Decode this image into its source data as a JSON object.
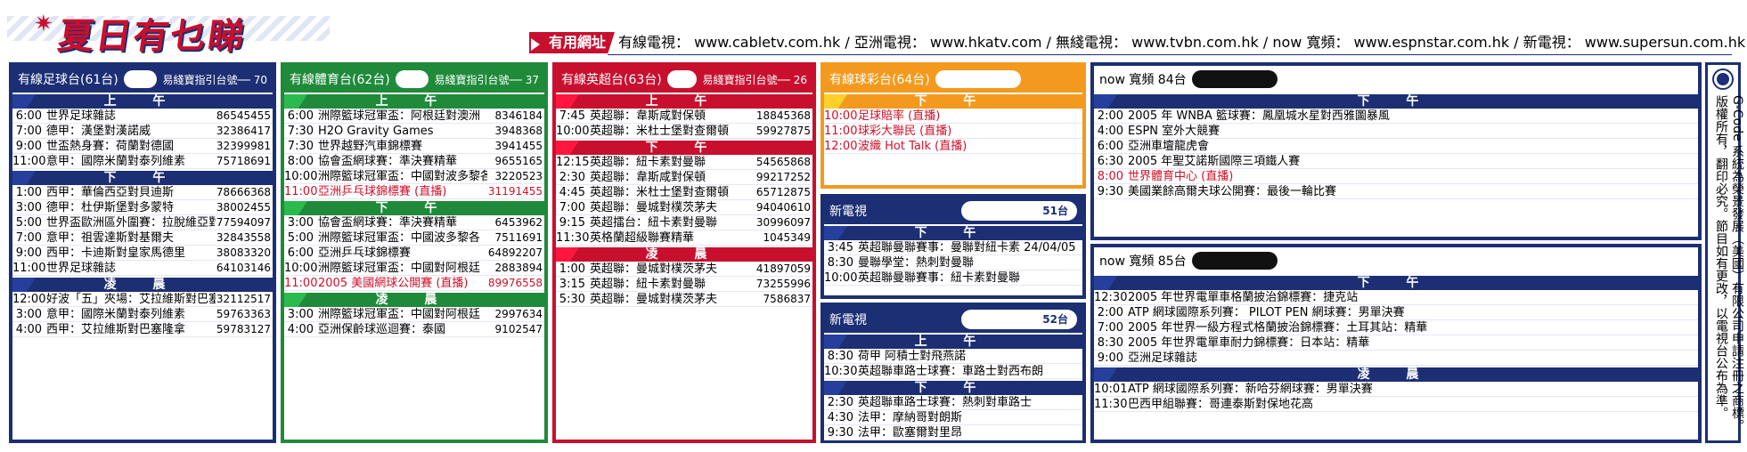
{
  "header": {
    "logo_text": "夏日有乜睇",
    "tag": "有用網址",
    "urls": "有線電視： www.cabletv.com.hk / 亞洲電視： www.hkatv.com / 無綫電視： www.tvbn.com.hk / now 寬頻： www.espnstar.com.hk / 新電視： www.supersun.com.hk"
  },
  "panel1": {
    "channel": "有線足球台(61台)",
    "guide": "易綫寶指引台號── 70",
    "period_am": "上 午",
    "period_pm": "下 午",
    "period_late": "凌 晨",
    "am": [
      {
        "t": "6:00",
        "p": "世界足球雜誌",
        "n": "86545455"
      },
      {
        "t": "7:00",
        "p": "德甲：漢堡對漢諾威",
        "n": "32386417"
      },
      {
        "t": "9:00",
        "p": "世盃熱身賽：荷蘭對德國",
        "n": "32399981"
      },
      {
        "t": "11:00",
        "p": "意甲：國際米蘭對泰列維素",
        "n": "75718691"
      }
    ],
    "pm": [
      {
        "t": "1:00",
        "p": "西甲：華倫西亞對貝迪斯",
        "n": "78666368"
      },
      {
        "t": "3:00",
        "p": "德甲：杜伊斯堡對多蒙特",
        "n": "38002455"
      },
      {
        "t": "5:00",
        "p": "世界盃歐洲區外圍賽：拉脫維亞對俄羅斯",
        "n": "77594097"
      },
      {
        "t": "7:00",
        "p": "意甲：祖雲達斯對基爾夫",
        "n": "32843558"
      },
      {
        "t": "9:00",
        "p": "西甲：卡迪斯對皇家馬德里",
        "n": "38083320"
      },
      {
        "t": "11:00",
        "p": "世界足球雜誌",
        "n": "64103146"
      }
    ],
    "late": [
      {
        "t": "12:00",
        "p": "好波「五」夾場：艾拉維斯對巴塞隆拿",
        "n": "32112517"
      },
      {
        "t": "3:00",
        "p": "意甲：國際米蘭對泰列維素",
        "n": "59763363"
      },
      {
        "t": "4:00",
        "p": "西甲：艾拉維斯對巴塞隆拿",
        "n": "59783127"
      }
    ]
  },
  "panel2": {
    "channel": "有線體育台(62台)",
    "guide": "易綫寶指引台號── 37",
    "period_am": "上 午",
    "period_pm": "下 午",
    "period_late": "凌 晨",
    "am": [
      {
        "t": "6:00",
        "p": "洲際籃球冠軍盃：阿根廷對澳洲",
        "n": "8346184"
      },
      {
        "t": "7:30",
        "p": "H2O Gravity Games",
        "n": "3948368"
      },
      {
        "t": "7:30",
        "p": "世界越野汽車錦標賽",
        "n": "3941455"
      },
      {
        "t": "8:00",
        "p": "協會盃網球賽：準決賽精華",
        "n": "9655165"
      },
      {
        "t": "10:00",
        "p": "洲際籃球冠軍盃：中國對波多黎各",
        "n": "3220523"
      },
      {
        "t": "11:00",
        "p": "亞洲乒乓球錦標賽 (直播)",
        "n": "31191455",
        "red": true
      }
    ],
    "pm": [
      {
        "t": "3:00",
        "p": "協會盃網球賽：準決賽精華",
        "n": "6453962"
      },
      {
        "t": "5:00",
        "p": "洲際籃球冠軍盃：中國波多黎各",
        "n": "7511691"
      },
      {
        "t": "6:00",
        "p": "亞洲乒乓球錦標賽",
        "n": "64892207"
      },
      {
        "t": "10:00",
        "p": "洲際籃球冠軍盃：中國對阿根廷",
        "n": "2883894"
      },
      {
        "t": "11:00",
        "p": "2005 美國網球公開賽 (直播)",
        "n": "89976558",
        "red": true
      }
    ],
    "late": [
      {
        "t": "3:00",
        "p": "洲際籃球冠軍盃：中國對阿根廷",
        "n": "2997634"
      },
      {
        "t": "4:00",
        "p": "亞洲保齡球巡迴賽：泰國",
        "n": "9102547"
      }
    ]
  },
  "panel3": {
    "channel": "有線英超台(63台)",
    "guide": "易綫寶指引台號── 26",
    "period_am": "上 午",
    "period_pm": "下 午",
    "period_late": "凌 晨",
    "am": [
      {
        "t": "7:45",
        "p": "英超聯：韋斯咸對保頓",
        "n": "18845368"
      },
      {
        "t": "10:00",
        "p": "英超聯：米杜士堡對查爾頓",
        "n": "59927875"
      }
    ],
    "pm": [
      {
        "t": "12:15",
        "p": "英超聯：紐卡素對曼聯",
        "n": "54565868"
      },
      {
        "t": "2:30",
        "p": "英超聯：韋斯咸對保頓",
        "n": "99217252"
      },
      {
        "t": "4:45",
        "p": "英超聯：米杜士堡對查爾頓",
        "n": "65712875"
      },
      {
        "t": "7:00",
        "p": "英超聯：曼城對樸茨茅夫",
        "n": "94040610"
      },
      {
        "t": "9:15",
        "p": "英超擂台：紐卡素對曼聯",
        "n": "30996097"
      },
      {
        "t": "11:30",
        "p": "英格蘭超級聯賽精華",
        "n": "1045349"
      }
    ],
    "late": [
      {
        "t": "1:00",
        "p": "英超聯：曼城對樸茨茅夫",
        "n": "41897059"
      },
      {
        "t": "3:15",
        "p": "英超聯：紐卡素對曼聯",
        "n": "73255996"
      },
      {
        "t": "5:30",
        "p": "英超聯：曼城對樸茨茅夫",
        "n": "7586837"
      }
    ]
  },
  "panel4": {
    "channel": "有線球彩台(64台)",
    "period_pm": "下 午",
    "pm": [
      {
        "t": "10:00",
        "p": "足球賠率 (直播)",
        "red": true
      },
      {
        "t": "11:00",
        "p": "球彩大聯民 (直播)",
        "red": true
      },
      {
        "t": "12:00",
        "p": "波織 Hot Talk (直播)",
        "red": true
      }
    ],
    "new1": {
      "channel": "新電視",
      "num": "51台",
      "period": "下 午",
      "rows": [
        {
          "t": "3:45",
          "p": "英超聯曼聯賽事：曼聯對紐卡素 24/04/05"
        },
        {
          "t": "8:30",
          "p": "曼聯學堂：熱刺對曼聯"
        },
        {
          "t": "10:00",
          "p": "英超聯曼聯賽事：紐卡素對曼聯"
        }
      ]
    },
    "new2": {
      "channel": "新電視",
      "num": "52台",
      "period_am": "上 午",
      "period_pm": "下 午",
      "am": [
        {
          "t": "8:30",
          "p": "荷甲 阿積士對飛燕諾"
        },
        {
          "t": "10:30",
          "p": "英超聯車路士球賽：車路士對西布朗"
        }
      ],
      "pm": [
        {
          "t": "2:30",
          "p": "英超聯車路士球賽：熱刺對車路士"
        },
        {
          "t": "4:30",
          "p": "法甲：摩納哥對朗斯"
        },
        {
          "t": "9:30",
          "p": "法甲：歐塞爾對里昂"
        }
      ]
    }
  },
  "panel5": {
    "ch84": "now 寬頻 84台",
    "ch85": "now 寬頻 85台",
    "period_pm": "下 午",
    "period_late": "凌 晨",
    "rows84": [
      {
        "t": "2:00",
        "p": "2005 年 WNBA 籃球賽：鳳凰城水星對西雅圖暴風"
      },
      {
        "t": "4:00",
        "p": "ESPN 室外大競賽"
      },
      {
        "t": "6:00",
        "p": "亞洲車壇龍虎會"
      },
      {
        "t": "6:30",
        "p": "2005 年聖艾諾斯國際三項鐵人賽"
      },
      {
        "t": "8:00",
        "p": "世界體育中心 (直播)",
        "red": true
      },
      {
        "t": "9:30",
        "p": "美國業餘高爾夫球公開賽：最後一輪比賽"
      }
    ],
    "rows85_pm": [
      {
        "t": "12:30",
        "p": "2005 年世界電單車格蘭披治錦標賽：捷克站"
      },
      {
        "t": "2:00",
        "p": "ATP 網球國際系列賽： PILOT PEN 網球賽：男單決賽"
      },
      {
        "t": "7:00",
        "p": "2005 年世界一級方程式格蘭披治錦標賽：土耳其站：精華"
      },
      {
        "t": "8:30",
        "p": "2005 年世界電單車耐力錦標賽：日本站：精華"
      },
      {
        "t": "9:00",
        "p": "亞洲足球雜誌"
      }
    ],
    "rows85_late": [
      {
        "t": "10:01",
        "p": "ATP 網球國際系列賽：新哈芬網球賽：男單決賽"
      },
      {
        "t": "11:30",
        "p": "巴西甲組聯賽：哥連泰斯對保地花高"
      }
    ]
  },
  "side": {
    "text": "G-Code 系統為榮景發展（美國）有限公司申請注冊之商標。版權所有，翻印必究。節目如有更改，以電視台公布為準。"
  },
  "colors": {
    "navy": "#1c2f74",
    "green": "#1f8a3a",
    "red": "#c8102e",
    "orange": "#f39a1e"
  }
}
